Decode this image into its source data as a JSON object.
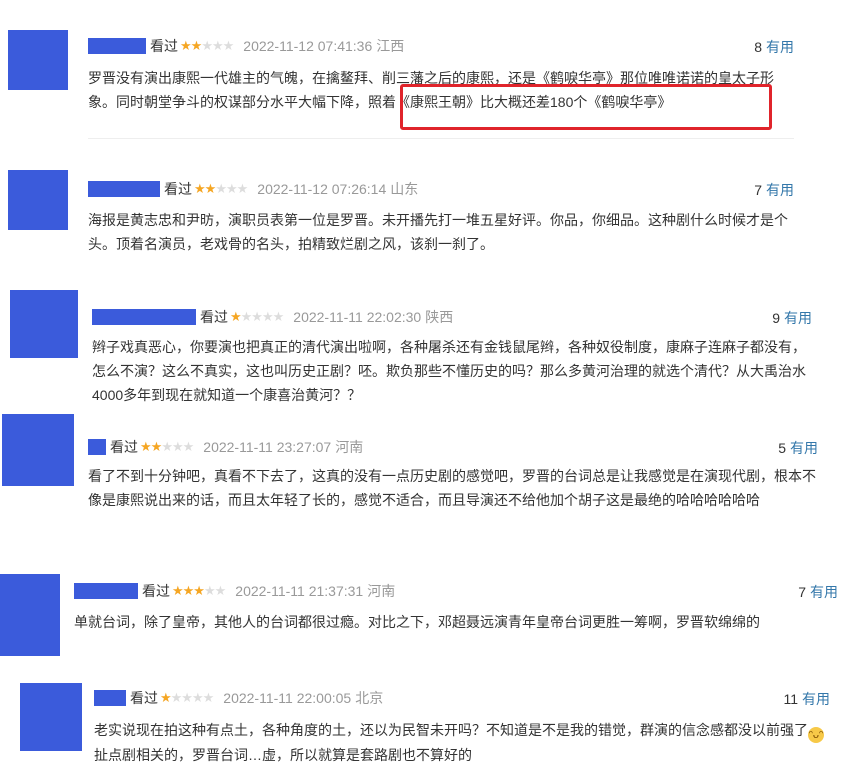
{
  "useful_label": "有用",
  "accent": "#3b5bdb",
  "star_color": "#f5a623",
  "link_color": "#3377aa",
  "comments": [
    {
      "seen": "看过",
      "rating": 2,
      "time": "2022-11-12 07:41:36",
      "location": "江西",
      "count": "8",
      "text": "罗晋没有演出康熙一代雄主的气魄，在擒鳌拜、削三藩之后的康熙，还是《鹤唳华亭》那位唯唯诺诺的皇太子形象。同时朝堂争斗的权谋部分水平大幅下降，照着《康熙王朝》比大概还差180个《鹤唳华亭》"
    },
    {
      "seen": "看过",
      "rating": 2,
      "time": "2022-11-12 07:26:14",
      "location": "山东",
      "count": "7",
      "text": "海报是黄志忠和尹昉，演职员表第一位是罗晋。未开播先打一堆五星好评。你品，你细品。这种剧什么时候才是个头。顶着名演员，老戏骨的名头，拍精致烂剧之风，该刹一刹了。"
    },
    {
      "seen": "看过",
      "rating": 1,
      "time": "2022-11-11 22:02:30",
      "location": "陕西",
      "count": "9",
      "text": "辫子戏真恶心，你要演也把真正的清代演出啦啊，各种屠杀还有金钱鼠尾辫，各种奴役制度，康麻子连麻子都没有，怎么不演？这么不真实，这也叫历史正剧？呸。欺负那些不懂历史的吗？那么多黄河治理的就选个清代？从大禹治水4000多年到现在就知道一个康喜治黄河？？"
    },
    {
      "seen": "看过",
      "rating": 2,
      "time": "2022-11-11 23:27:07",
      "location": "河南",
      "count": "5",
      "text": "看了不到十分钟吧，真看不下去了，这真的没有一点历史剧的感觉吧，罗晋的台词总是让我感觉是在演现代剧，根本不像是康熙说出来的话，而且太年轻了长的，感觉不适合，而且导演还不给他加个胡子这是最绝的哈哈哈哈哈哈"
    },
    {
      "seen": "看过",
      "rating": 3,
      "time": "2022-11-11 21:37:31",
      "location": "河南",
      "count": "7",
      "text": "单就台词，除了皇帝，其他人的台词都很过瘾。对比之下，邓超聂远演青年皇帝台词更胜一筹啊，罗晋软绵绵的"
    },
    {
      "seen": "看过",
      "rating": 1,
      "time": "2022-11-11 22:00:05",
      "location": "北京",
      "count": "11",
      "text_a": "老实说现在拍这种有点土，各种角度的土，还以为民智未开吗？不知道是不是我的错觉，群演的信念感都没以前强了",
      "emoji": "laughing-face",
      "text_b": " 扯点剧相关的，罗晋台词…虚，所以就算是套路剧也不算好的"
    }
  ]
}
